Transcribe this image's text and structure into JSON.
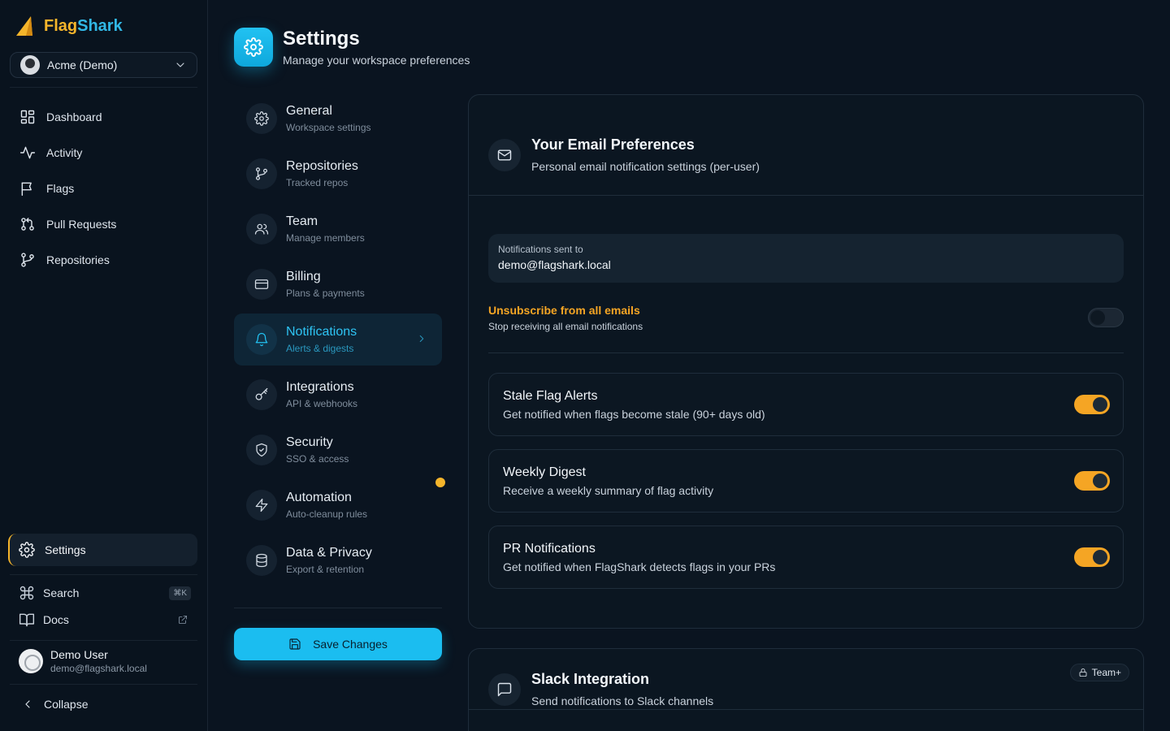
{
  "brand": {
    "part1": "Flag",
    "part2": "Shark"
  },
  "workspace": {
    "name": "Acme (Demo)"
  },
  "nav": {
    "items": [
      {
        "label": "Dashboard",
        "icon": "dashboard-icon"
      },
      {
        "label": "Activity",
        "icon": "activity-icon"
      },
      {
        "label": "Flags",
        "icon": "flag-icon"
      },
      {
        "label": "Pull Requests",
        "icon": "pull-request-icon"
      },
      {
        "label": "Repositories",
        "icon": "branch-icon"
      }
    ],
    "settings": "Settings",
    "search": "Search",
    "search_shortcut": "⌘K",
    "docs": "Docs",
    "collapse": "Collapse"
  },
  "user": {
    "name": "Demo User",
    "email": "demo@flagshark.local"
  },
  "header": {
    "title": "Settings",
    "subtitle": "Manage your workspace preferences"
  },
  "subnav": {
    "items": [
      {
        "title": "General",
        "desc": "Workspace settings"
      },
      {
        "title": "Repositories",
        "desc": "Tracked repos"
      },
      {
        "title": "Team",
        "desc": "Manage members"
      },
      {
        "title": "Billing",
        "desc": "Plans & payments"
      },
      {
        "title": "Notifications",
        "desc": "Alerts & digests"
      },
      {
        "title": "Integrations",
        "desc": "API & webhooks"
      },
      {
        "title": "Security",
        "desc": "SSO & access"
      },
      {
        "title": "Automation",
        "desc": "Auto-cleanup rules"
      },
      {
        "title": "Data & Privacy",
        "desc": "Export & retention"
      }
    ],
    "save_label": "Save Changes"
  },
  "email_card": {
    "title": "Your Email Preferences",
    "subtitle": "Personal email notification settings (per-user)",
    "sent_to_label": "Notifications sent to",
    "sent_to_value": "demo@flagshark.local",
    "unsubscribe_title": "Unsubscribe from all emails",
    "unsubscribe_desc": "Stop receiving all email notifications",
    "unsubscribe_enabled": false,
    "prefs": [
      {
        "title": "Stale Flag Alerts",
        "desc": "Get notified when flags become stale (90+ days old)",
        "enabled": true
      },
      {
        "title": "Weekly Digest",
        "desc": "Receive a weekly summary of flag activity",
        "enabled": true
      },
      {
        "title": "PR Notifications",
        "desc": "Get notified when FlagShark detects flags in your PRs",
        "enabled": true
      }
    ]
  },
  "slack_card": {
    "title": "Slack Integration",
    "subtitle": "Send notifications to Slack channels",
    "badge": "Team+"
  },
  "colors": {
    "accent": "#1bbdf0",
    "warning": "#f5a524",
    "brand_yellow": "#f5b52b",
    "background": "#0a1420"
  }
}
